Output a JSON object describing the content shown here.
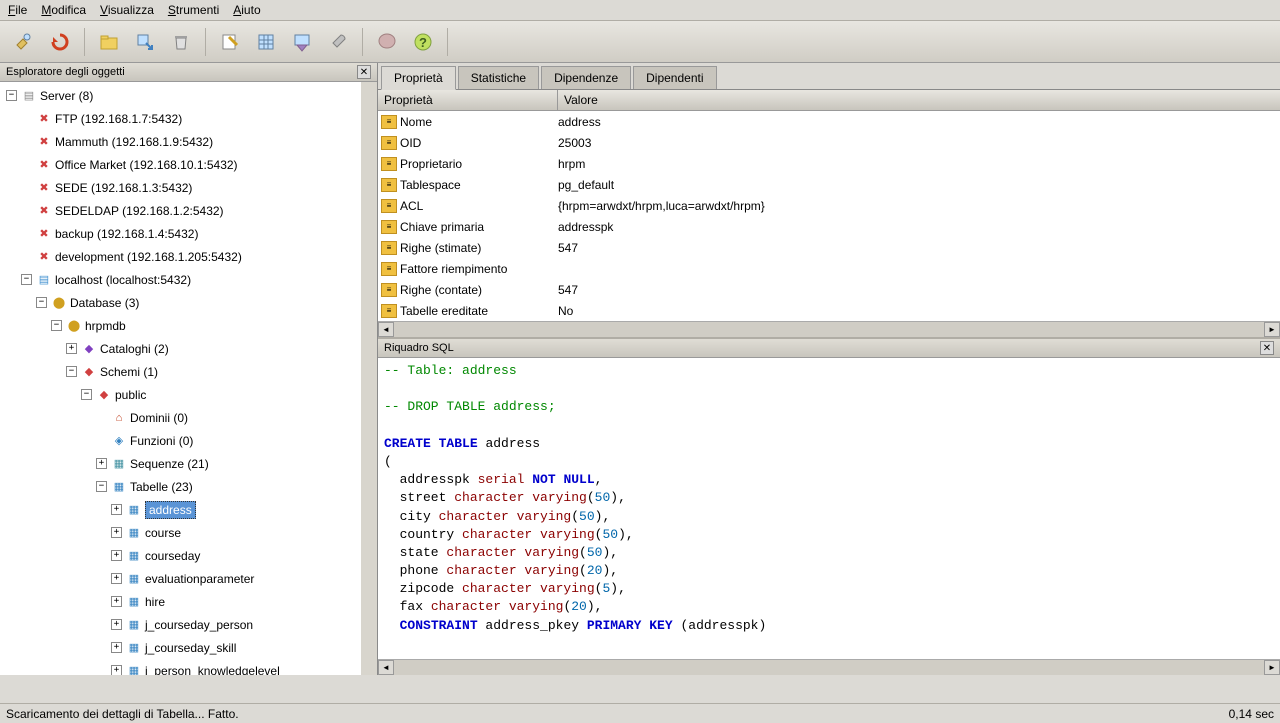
{
  "menu": {
    "file": "File",
    "edit": "Modifica",
    "view": "Visualizza",
    "tools": "Strumenti",
    "help": "Aiuto"
  },
  "explorer": {
    "title": "Esploratore degli oggetti",
    "servers_label": "Server (8)",
    "servers": [
      "FTP (192.168.1.7:5432)",
      "Mammuth (192.168.1.9:5432)",
      "Office Market (192.168.10.1:5432)",
      "SEDE (192.168.1.3:5432)",
      "SEDELDAP (192.168.1.2:5432)",
      "backup (192.168.1.4:5432)",
      "development (192.168.1.205:5432)"
    ],
    "localhost": "localhost (localhost:5432)",
    "database": "Database (3)",
    "dbname": "hrpmdb",
    "catalogs": "Cataloghi (2)",
    "schemas": "Schemi (1)",
    "public": "public",
    "domains": "Dominii (0)",
    "functions": "Funzioni (0)",
    "sequences": "Sequenze (21)",
    "tables_label": "Tabelle (23)",
    "tables": [
      "address",
      "course",
      "courseday",
      "evaluationparameter",
      "hire",
      "j_courseday_person",
      "j_courseday_skill",
      "j_person_knowledgelevel"
    ]
  },
  "tabs": {
    "props": "Proprietà",
    "stats": "Statistiche",
    "deps": "Dipendenze",
    "dependents": "Dipendenti"
  },
  "props_header": {
    "name": "Proprietà",
    "value": "Valore"
  },
  "props": [
    {
      "n": "Nome",
      "v": "address"
    },
    {
      "n": "OID",
      "v": "25003"
    },
    {
      "n": "Proprietario",
      "v": "hrpm"
    },
    {
      "n": "Tablespace",
      "v": "pg_default"
    },
    {
      "n": "ACL",
      "v": "{hrpm=arwdxt/hrpm,luca=arwdxt/hrpm}"
    },
    {
      "n": "Chiave primaria",
      "v": "addresspk"
    },
    {
      "n": "Righe (stimate)",
      "v": "547"
    },
    {
      "n": "Fattore riempimento",
      "v": ""
    },
    {
      "n": "Righe (contate)",
      "v": "547"
    },
    {
      "n": "Tabelle ereditate",
      "v": "No"
    }
  ],
  "sql_panel": {
    "title": "Riquadro SQL"
  },
  "status": {
    "text": "Scaricamento dei dettagli di Tabella... Fatto.",
    "time": "0,14 sec"
  }
}
